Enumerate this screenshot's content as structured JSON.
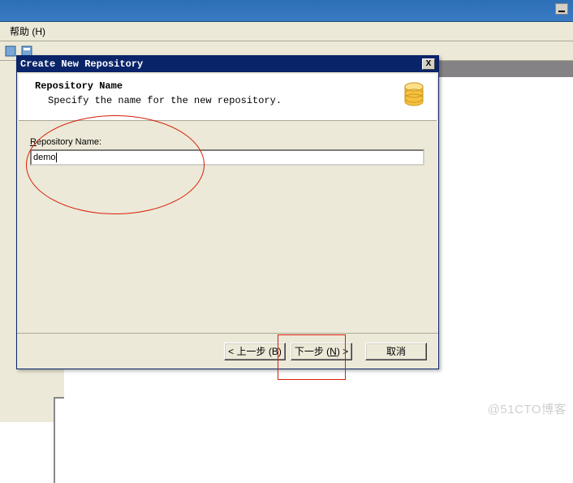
{
  "menubar": {
    "help": "帮助 (H)"
  },
  "dialog": {
    "title": "Create New Repository",
    "close_label": "X",
    "heading": "Repository Name",
    "subheading": "Specify the name for the new repository.",
    "field_label_pre": "R",
    "field_label_post": "epository Name:",
    "field_value": "demo"
  },
  "buttons": {
    "back": "< 上一步 (B)",
    "next_pre": "下一步 (",
    "next_key": "N",
    "next_post": ") >",
    "cancel": "取消"
  },
  "watermark": "@51CTO博客"
}
